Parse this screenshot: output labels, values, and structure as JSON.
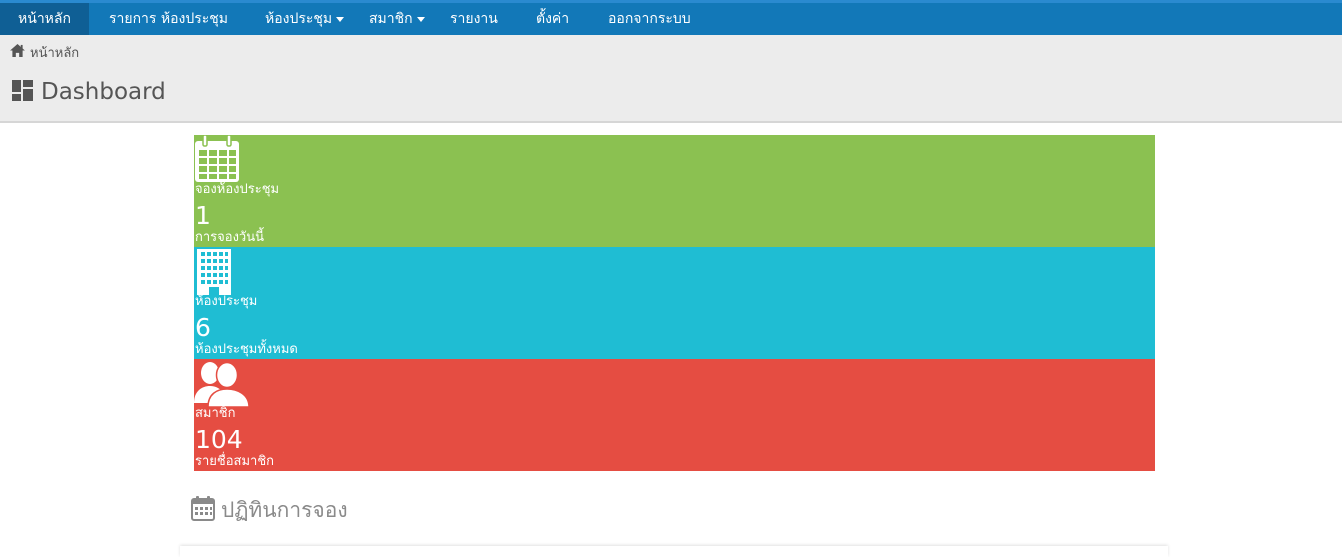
{
  "colors": {
    "nav_bg": "#1278b8",
    "nav_active": "#0f5f95",
    "header_bg": "#ececec",
    "card_booking": "#8bc151",
    "card_rooms": "#1fbdd3",
    "card_members": "#e54d42"
  },
  "nav": {
    "items": [
      {
        "label": "หน้าหลัก",
        "active": true
      },
      {
        "label": "รายการ ห้องประชุม"
      },
      {
        "label": "ห้องประชุม",
        "dropdown": true
      },
      {
        "label": "สมาชิก",
        "dropdown": true
      },
      {
        "label": "รายงาน"
      },
      {
        "label": "ตั้งค่า"
      },
      {
        "label": "ออกจากระบบ"
      }
    ]
  },
  "breadcrumb": {
    "icon": "home-icon",
    "label": "หน้าหลัก"
  },
  "page": {
    "icon": "dashboard-icon",
    "title": "Dashboard"
  },
  "cards": [
    {
      "icon": "calendar-icon",
      "label": "จองห้องประชุม",
      "count": "1",
      "sub": "การจองวันนี้"
    },
    {
      "icon": "building-icon",
      "label": "ห้องประชุม",
      "count": "6",
      "sub": "ห้องประชุมทั้งหมด"
    },
    {
      "icon": "users-icon",
      "label": "สมาชิก",
      "count": "104",
      "sub": "รายชื่อสมาชิก"
    }
  ],
  "calendar": {
    "icon": "calendar-icon",
    "title": "ปฏิทินการจอง"
  }
}
